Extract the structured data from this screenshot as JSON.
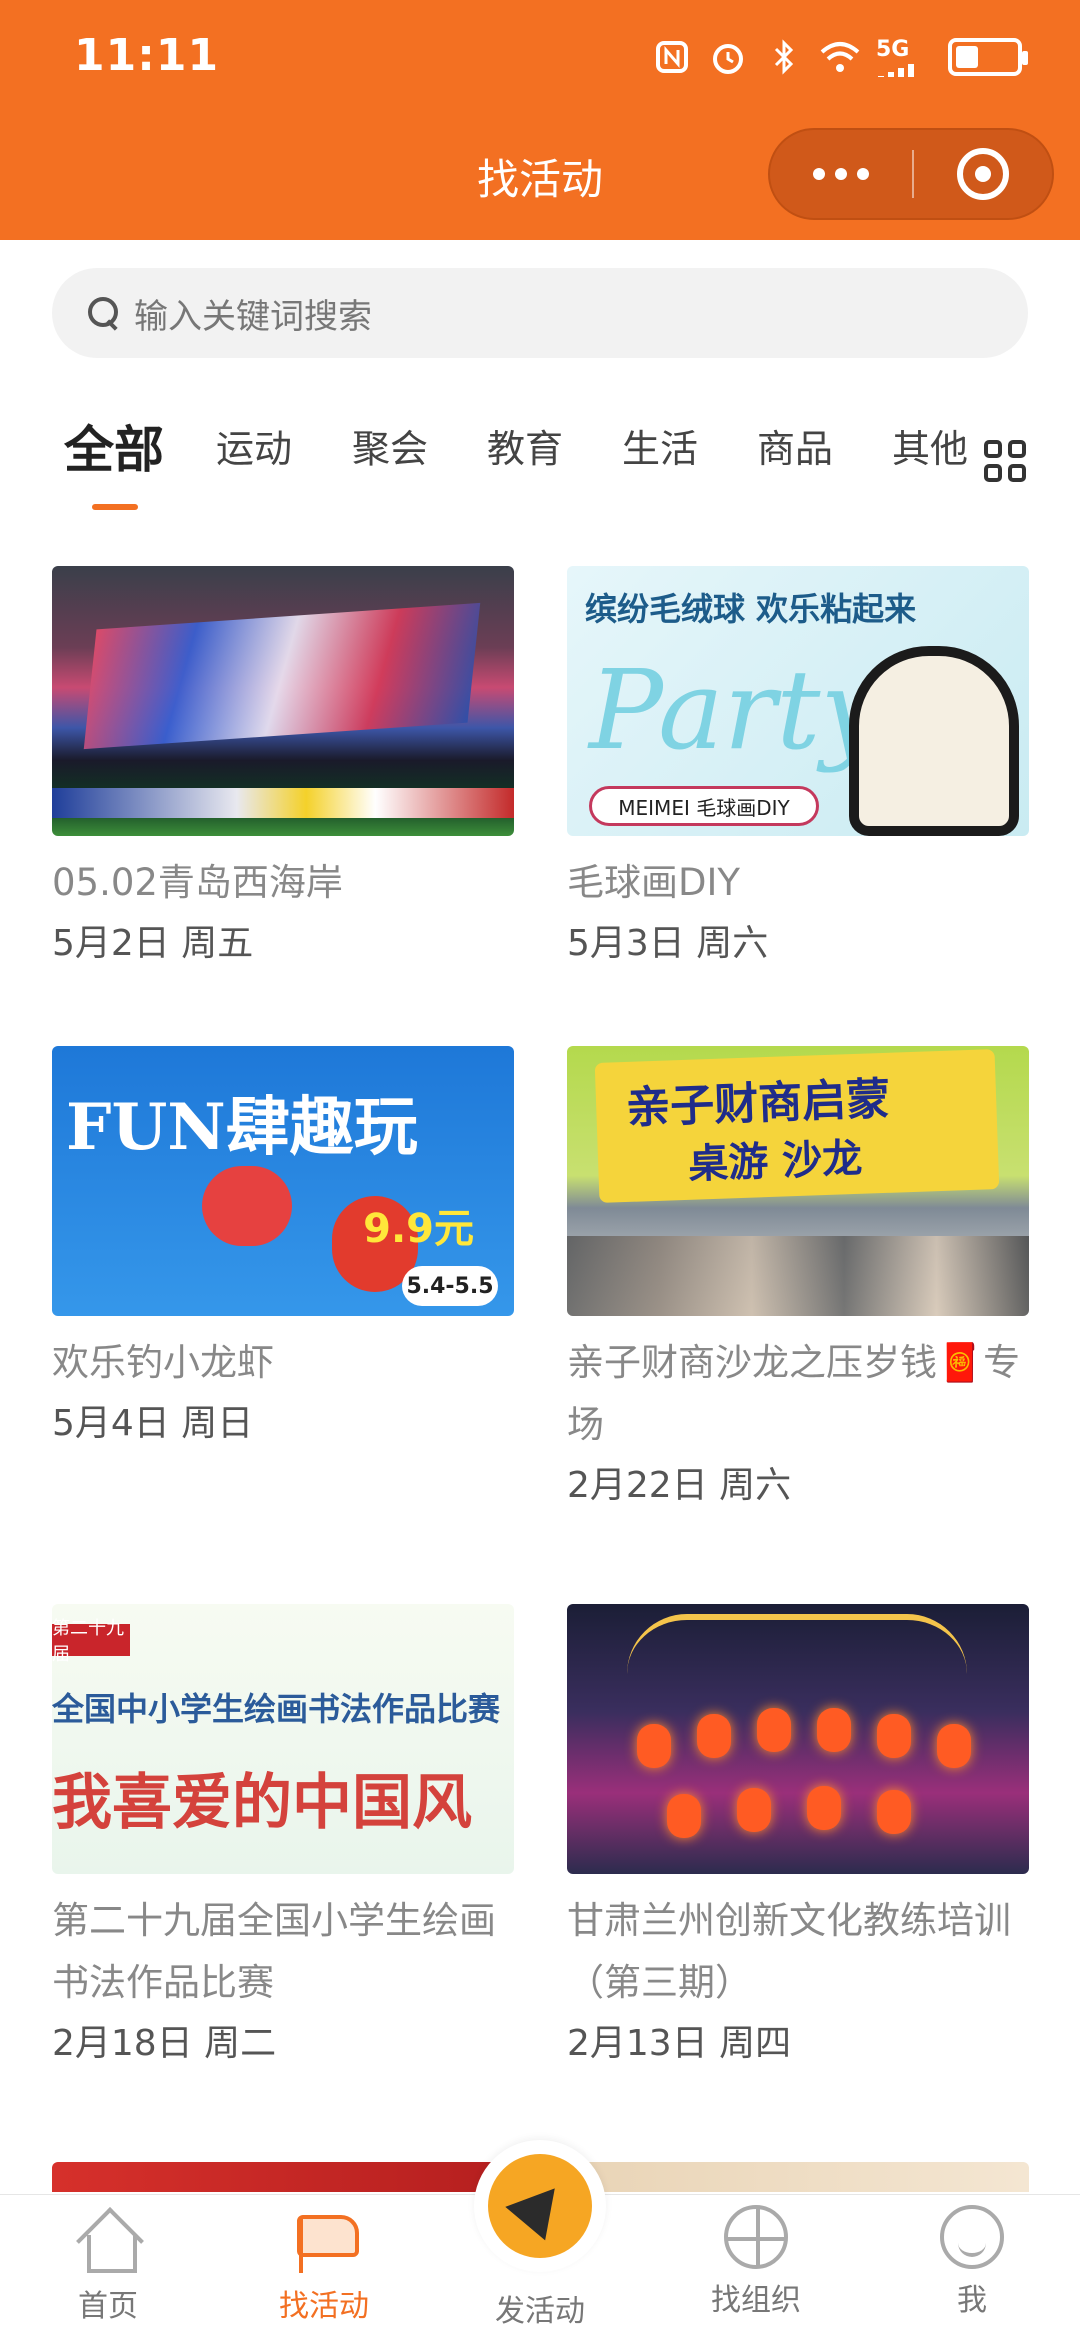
{
  "status_bar": {
    "time": "11:11",
    "network": "5G"
  },
  "header": {
    "title": "找活动"
  },
  "search": {
    "placeholder": "输入关键词搜索"
  },
  "tabs": [
    {
      "label": "全部",
      "active": true
    },
    {
      "label": "运动"
    },
    {
      "label": "聚会"
    },
    {
      "label": "教育"
    },
    {
      "label": "生活"
    },
    {
      "label": "商品"
    },
    {
      "label": "其他"
    }
  ],
  "events": [
    {
      "title": "05.02青岛西海岸",
      "date": "5月2日 周五",
      "image": "soccer-stadium-banner"
    },
    {
      "title": "毛球画DIY",
      "date": "5月3日 周六",
      "image": "party-poster",
      "image_text": {
        "head": "缤纷毛绒球 欢乐粘起来",
        "party": "Party",
        "tag": "MEIMEI 毛球画DIY"
      }
    },
    {
      "title": "欢乐钓小龙虾",
      "date": "5月4日 周日",
      "image": "crayfish-poster",
      "image_text": {
        "fun": "FUN肆趣玩",
        "price": "9.9元",
        "range": "5.4-5.5"
      }
    },
    {
      "title": "亲子财商沙龙之压岁钱🧧专场",
      "date": "2月22日 周六",
      "image": "board-game-salon",
      "image_text": {
        "l1": "亲子财商启蒙",
        "l2": "桌游 沙龙"
      }
    },
    {
      "title": "第二十九届全国小学生绘画书法作品比赛",
      "date": "2月18日 周二",
      "image": "art-contest-poster",
      "image_text": {
        "badge": "第二十九届",
        "l1": "全国中小学生绘画书法作品比赛",
        "l2": "我喜爱的中国风"
      }
    },
    {
      "title": "甘肃兰州创新文化教练培训（第三期）",
      "date": "2月13日 周四",
      "image": "lantern-bridge-night"
    }
  ],
  "bottom_nav": [
    {
      "label": "首页",
      "icon": "home-icon"
    },
    {
      "label": "找活动",
      "icon": "flag-icon",
      "active": true
    },
    {
      "label": "发活动",
      "icon": "paper-plane-icon"
    },
    {
      "label": "找组织",
      "icon": "basketball-icon"
    },
    {
      "label": "我",
      "icon": "profile-icon"
    }
  ],
  "colors": {
    "brand": "#f37022",
    "publish": "#f6a623"
  }
}
